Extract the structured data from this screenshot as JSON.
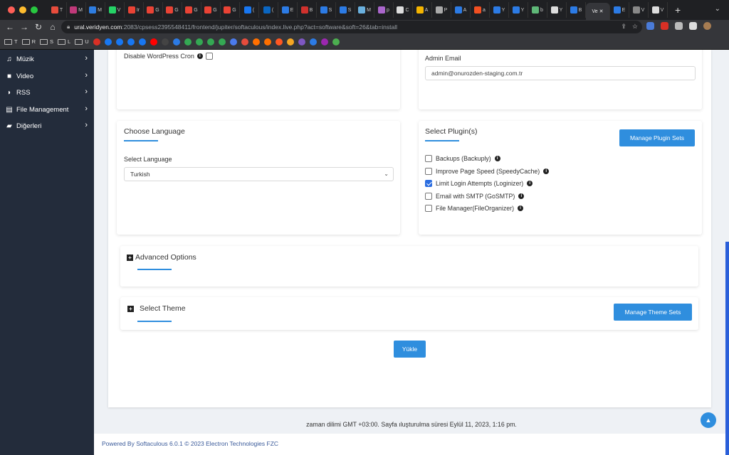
{
  "browser": {
    "tabs": [
      {
        "letter": "T",
        "color": "#e74c3c"
      },
      {
        "letter": "M",
        "color": "#c0397a"
      },
      {
        "letter": "M",
        "color": "#2e7de1"
      },
      {
        "letter": "V",
        "color": "#25d366"
      },
      {
        "letter": "Ir",
        "color": "#ea4335"
      },
      {
        "letter": "G",
        "color": "#ea4335"
      },
      {
        "letter": "G",
        "color": "#ea4335"
      },
      {
        "letter": "G",
        "color": "#ea4335"
      },
      {
        "letter": "G",
        "color": "#ea4335"
      },
      {
        "letter": "G",
        "color": "#ea4335"
      },
      {
        "letter": "(",
        "color": "#1877f2"
      },
      {
        "letter": "(",
        "color": "#0a66c2"
      },
      {
        "letter": "E",
        "color": "#2c7be5"
      },
      {
        "letter": "B",
        "color": "#d0312d"
      },
      {
        "letter": "S",
        "color": "#2c7be5"
      },
      {
        "letter": "S",
        "color": "#2c7be5"
      },
      {
        "letter": "M",
        "color": "#6ab0de"
      },
      {
        "letter": "p",
        "color": "#aa66cc"
      },
      {
        "letter": "C",
        "color": "#dddddd"
      },
      {
        "letter": "A",
        "color": "#f4b400"
      },
      {
        "letter": "P",
        "color": "#aaaaaa"
      },
      {
        "letter": "A",
        "color": "#2c7be5"
      },
      {
        "letter": "a",
        "color": "#f25022"
      },
      {
        "letter": "Y",
        "color": "#2c7be5"
      },
      {
        "letter": "Y",
        "color": "#2c7be5"
      },
      {
        "letter": "b",
        "color": "#5fb878"
      },
      {
        "letter": "Y",
        "color": "#dddddd"
      },
      {
        "letter": "B",
        "color": "#2c7be5"
      }
    ],
    "active_tab": {
      "letter": "Ve",
      "close": "✕"
    },
    "tabs_after": [
      {
        "letter": "E",
        "color": "#2c7be5"
      },
      {
        "letter": "V",
        "color": "#888888"
      },
      {
        "letter": "V",
        "color": "#dddddd"
      }
    ],
    "new_tab": "+",
    "url_host": "ural.veridyen.com",
    "url_rest": ":2083/cpsess2395548411/frontend/jupiter/softaculous/index.live.php?act=software&soft=26&tab=install",
    "bookmarks": [
      {
        "label": "T",
        "folder": true
      },
      {
        "label": "R",
        "folder": true
      },
      {
        "label": "S",
        "folder": true
      },
      {
        "label": "L",
        "folder": true
      },
      {
        "label": "U",
        "folder": true
      }
    ],
    "bookmark_icons": [
      "#d93025",
      "#1877f2",
      "#1877f2",
      "#1877f2",
      "#1877f2",
      "#ff0000",
      "#444444",
      "#2c7be5",
      "#34a853",
      "#34a853",
      "#34a853",
      "#34a853",
      "#4b7bec",
      "#e74c3c",
      "#ff6f00",
      "#ff6f00",
      "#ff5722",
      "#f5a623",
      "#7e57c2",
      "#2c7be5",
      "#9c27b0",
      "#4caf50"
    ]
  },
  "sidebar": {
    "items": [
      {
        "label": "Müzik",
        "icon": "music-icon",
        "glyph": "♫"
      },
      {
        "label": "Video",
        "icon": "video-icon",
        "glyph": "■"
      },
      {
        "label": "RSS",
        "icon": "rss-icon",
        "glyph": "◗"
      },
      {
        "label": "File Management",
        "icon": "file-icon",
        "glyph": "▤"
      },
      {
        "label": "Diğerleri",
        "icon": "folder-icon",
        "glyph": "▰"
      }
    ],
    "arrow": "›"
  },
  "cron": {
    "label": "Disable WordPress Cron",
    "checked": false
  },
  "admin": {
    "label": "Admin Email",
    "value": "admin@onurozden-staging.com.tr"
  },
  "language": {
    "heading": "Choose Language",
    "select_label": "Select Language",
    "selected": "Turkish"
  },
  "plugins": {
    "heading": "Select Plugin(s)",
    "manage_button": "Manage Plugin Sets",
    "items": [
      {
        "label": "Backups (Backuply)",
        "checked": false
      },
      {
        "label": "Improve Page Speed (SpeedyCache)",
        "checked": false
      },
      {
        "label": "Limit Login Attempts (Loginizer)",
        "checked": true
      },
      {
        "label": "Email with SMTP (GoSMTP)",
        "checked": false
      },
      {
        "label": "File Manager(FileOrganizer)",
        "checked": false
      }
    ]
  },
  "advanced": {
    "label": "Advanced Options"
  },
  "theme": {
    "label": "Select Theme",
    "manage_button": "Manage Theme Sets"
  },
  "install_button": "Yükle",
  "footer": {
    "timezone_text": "zaman dilimi GMT +03:00. Sayfa ıluşturulma süresi Eylül 11, 2023, 1:16 pm.",
    "powered": "Powered By Softaculous 6.0.1 © 2023 Electron Technologies FZC"
  },
  "colors": {
    "accent": "#2f8ede",
    "sidebar": "#232c3b"
  }
}
